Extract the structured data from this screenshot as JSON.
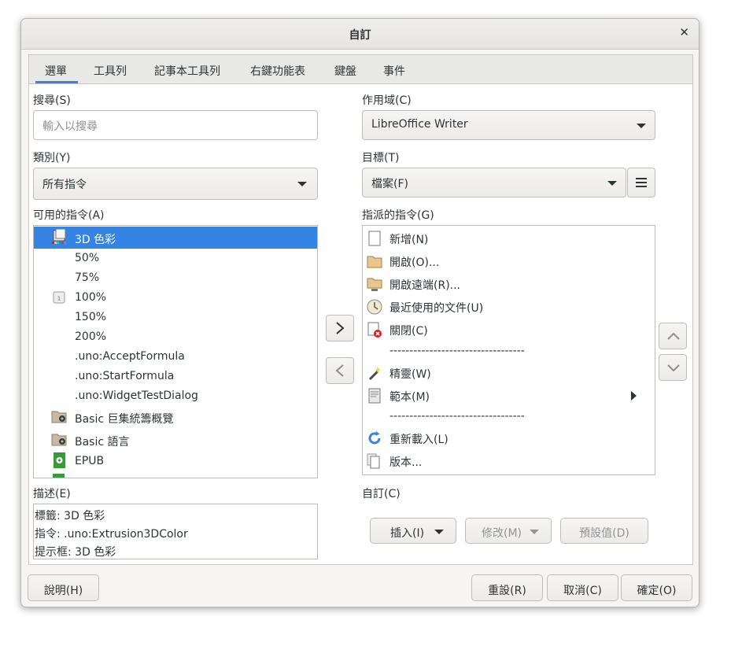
{
  "window": {
    "title": "自訂"
  },
  "tabs": [
    "選單",
    "工具列",
    "記事本工具列",
    "右鍵功能表",
    "鍵盤",
    "事件"
  ],
  "search": {
    "label": "搜尋(S)",
    "placeholder": "輸入以搜尋"
  },
  "category": {
    "label": "類別(Y)",
    "value": "所有指令"
  },
  "available": {
    "label": "可用的指令(A)",
    "items": [
      "3D 色彩",
      "50%",
      "75%",
      "100%",
      "150%",
      "200%",
      ".uno:AcceptFormula",
      ".uno:StartFormula",
      ".uno:WidgetTestDialog",
      "Basic 巨集統籌概覽",
      "Basic 語言",
      "EPUB"
    ],
    "selected_index": 0
  },
  "scope": {
    "label": "作用域(C)",
    "value": "LibreOffice Writer"
  },
  "target": {
    "label": "目標(T)",
    "value": "檔案(F)"
  },
  "assigned": {
    "label": "指派的指令(G)",
    "items": [
      "新增(N)",
      "開啟(O)...",
      "開啟遠端(R)...",
      "最近使用的文件(U)",
      "關閉(C)",
      "----------------------------------",
      "精靈(W)",
      "範本(M)",
      "----------------------------------",
      "重新載入(L)",
      "版本..."
    ]
  },
  "description": {
    "label": "描述(E)",
    "lines": [
      "標籤: 3D 色彩",
      "指令: .uno:Extrusion3DColor",
      "提示框: 3D 色彩"
    ]
  },
  "customize": {
    "label": "自訂(C)",
    "insert": "插入(I)",
    "modify": "修改(M)",
    "defaults": "預設值(D)"
  },
  "footer": {
    "help": "說明(H)",
    "reset": "重設(R)",
    "cancel": "取消(C)",
    "ok": "確定(O)"
  },
  "colors": {
    "accent": "#3584e4"
  }
}
